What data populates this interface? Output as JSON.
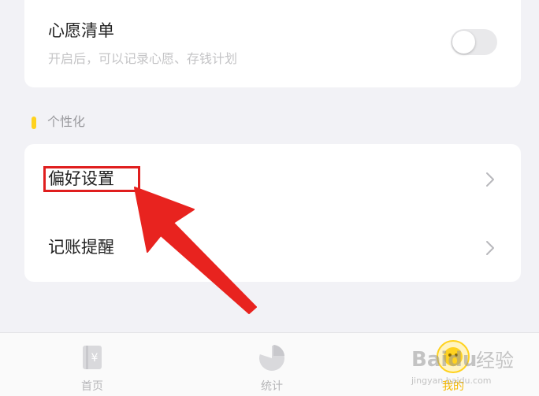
{
  "wish_list": {
    "title": "心愿清单",
    "subtitle": "开启后，可以记录心愿、存钱计划",
    "toggle_on": false
  },
  "personalization": {
    "section_label": "个性化",
    "items": [
      {
        "label": "偏好设置",
        "highlighted": true
      },
      {
        "label": "记账提醒",
        "highlighted": false
      }
    ]
  },
  "tabbar": {
    "tabs": [
      {
        "label": "首页",
        "icon": "ledger-icon",
        "active": false
      },
      {
        "label": "统计",
        "icon": "pie-chart-icon",
        "active": false
      },
      {
        "label": "我的",
        "icon": "profile-icon",
        "active": true
      }
    ]
  },
  "watermark": {
    "brand": "Baidu",
    "text": "经验",
    "url": "jingyan.baidu.com"
  },
  "colors": {
    "accent": "#ffd21f",
    "active_tab": "#f5b800",
    "annotation_red": "#e01e1e",
    "background": "#f2f2f6"
  }
}
